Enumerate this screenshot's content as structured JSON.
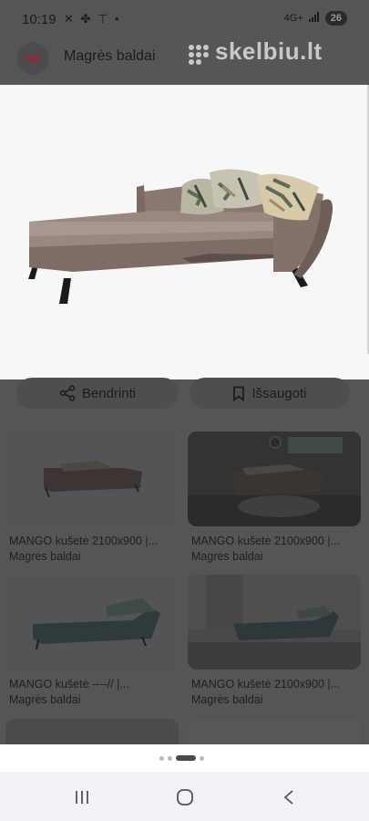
{
  "status_bar": {
    "time": "10:19",
    "notification_icons": [
      "messenger-icon",
      "fan-icon",
      "antenna-icon",
      "dot-icon"
    ],
    "network_label": "4G+",
    "battery": "26"
  },
  "header": {
    "brand_name": "Magrės baldai",
    "site_logo": "skelbiu.lt"
  },
  "actions": {
    "share_label": "Bendrinti",
    "save_label": "Išsaugoti"
  },
  "related": [
    {
      "title": "MANGO kušetė 2100x900 |...",
      "seller": "Magrės baldai"
    },
    {
      "title": "MANGO kušetė 2100x900 |...",
      "seller": "Magrės baldai"
    },
    {
      "title": "MANGO kušetė ----// |...",
      "seller": "Magrės baldai"
    },
    {
      "title": "MANGO kušetė 2100x900 |...",
      "seller": "Magrės baldai"
    }
  ],
  "pager": {
    "count": 4,
    "active_index": 2
  },
  "colors": {
    "scrim": "#555557",
    "sofa": "#8c7a73",
    "accent_logo": "#c0304a"
  }
}
